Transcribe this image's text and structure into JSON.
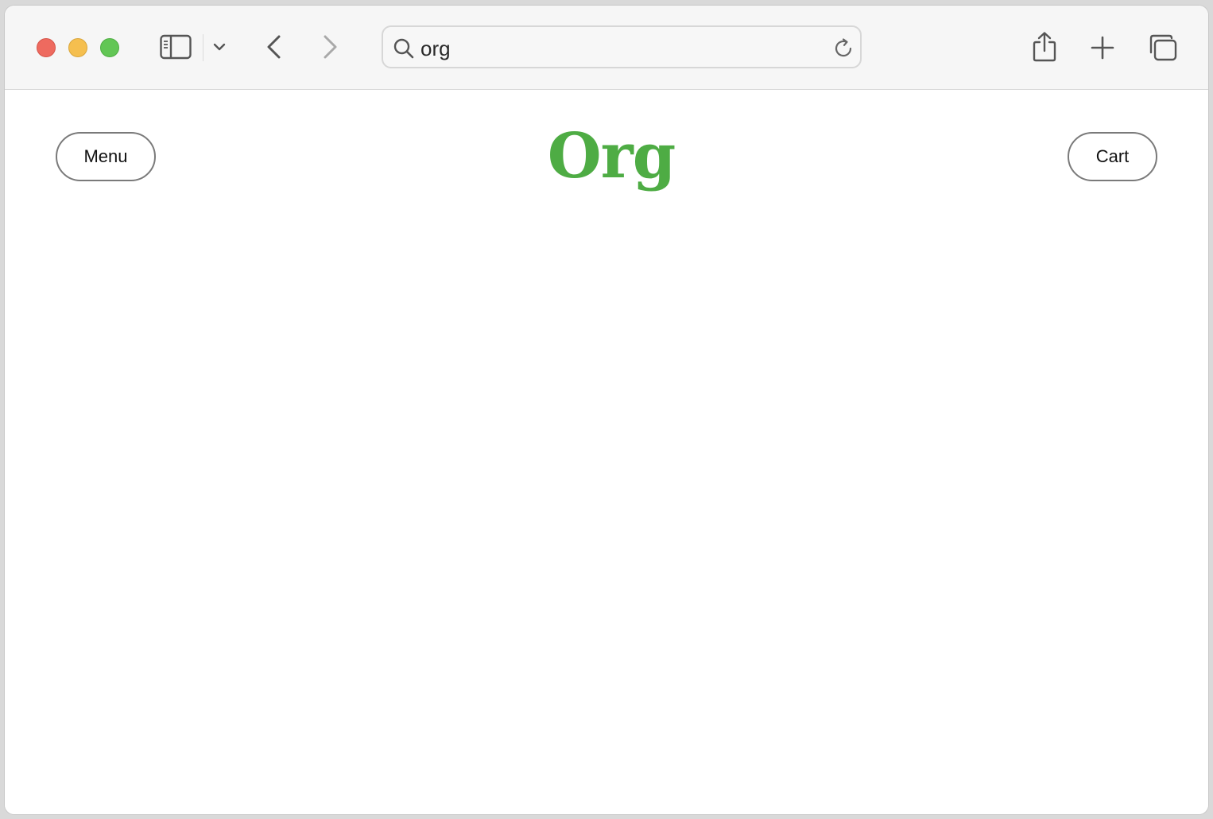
{
  "browser": {
    "address_bar": {
      "value": "org"
    },
    "icons": {
      "sidebar": "sidebar-icon",
      "chevron": "chevron-down-icon",
      "back": "chevron-left-icon",
      "forward": "chevron-right-icon",
      "search": "search-icon",
      "reload": "reload-icon",
      "share": "share-icon",
      "new_tab": "plus-icon",
      "tabs": "tab-overview-icon"
    },
    "colors": {
      "close": "#ee6a5f",
      "minimize": "#f5bf4f",
      "maximize": "#62c655"
    }
  },
  "page": {
    "title": "Org",
    "title_color": "#4eac44",
    "menu_label": "Menu",
    "cart_label": "Cart"
  }
}
